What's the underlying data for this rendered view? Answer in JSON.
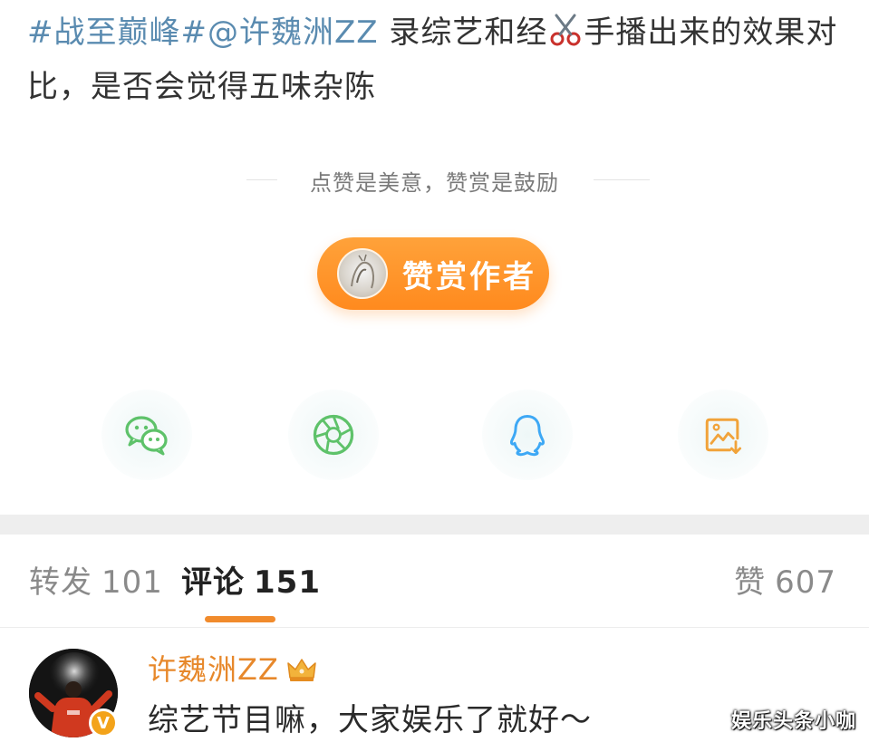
{
  "post": {
    "topic": "#战至巅峰#",
    "mention": "@许魏洲ZZ",
    "text_before_icon": " 录综艺和经",
    "icon": "scissors-icon",
    "text_after_icon": "手播出来的效果对比，是否会觉得五味杂陈"
  },
  "reward": {
    "caption": "点赞是美意，赞赏是鼓励",
    "button_label": "赞赏作者"
  },
  "share": {
    "icons": [
      "wechat-icon",
      "moments-icon",
      "qq-icon",
      "save-image-icon"
    ]
  },
  "tabs": {
    "repost": {
      "label": "转发",
      "count": "101"
    },
    "comments": {
      "label": "评论",
      "count": "151"
    },
    "likes": {
      "label": "赞",
      "count": "607"
    }
  },
  "comment": {
    "username": "许魏洲ZZ",
    "badge": "V",
    "text": "综艺节目嘛，大家娱乐了就好～"
  },
  "watermark": "娱乐头条小咖",
  "colors": {
    "accent": "#f18b2c",
    "link": "#5a8bb0",
    "username": "#e7882b",
    "wechat": "#5ec26a",
    "qq": "#3da8f5",
    "save": "#f1a33a"
  }
}
